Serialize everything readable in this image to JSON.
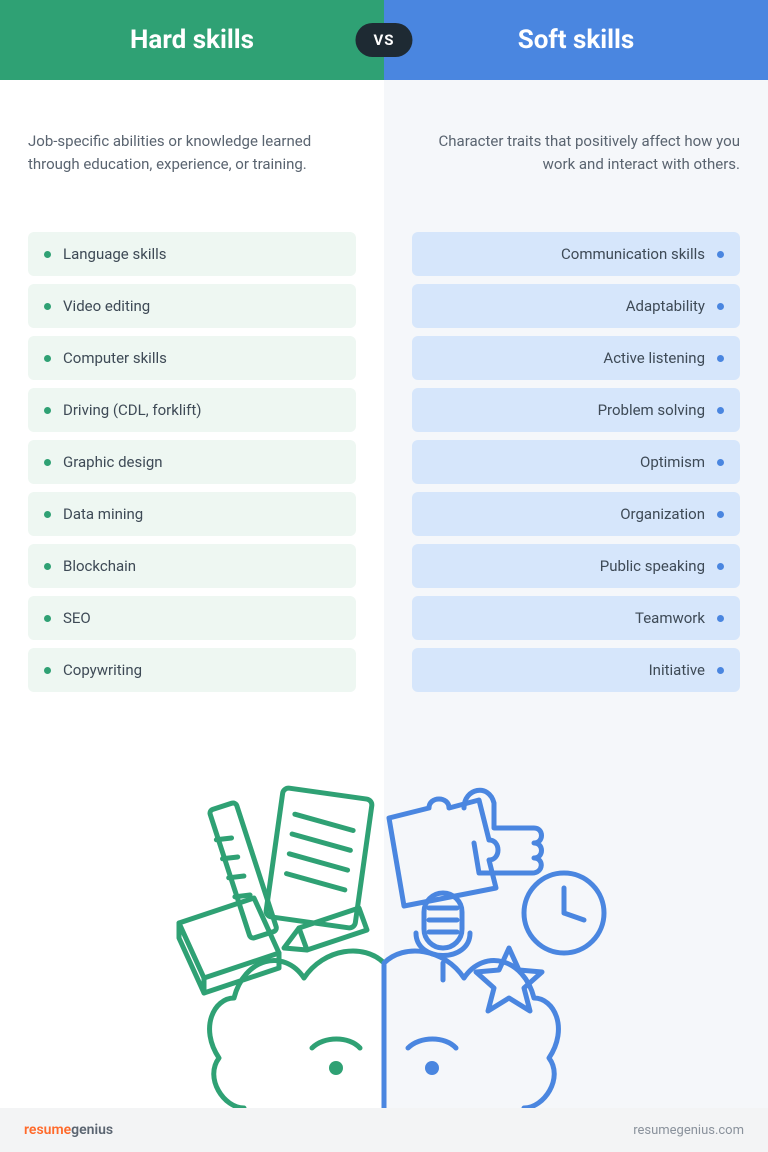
{
  "header": {
    "left_title": "Hard skills",
    "right_title": "Soft skills",
    "vs_label": "VS"
  },
  "left": {
    "description": "Job-specific abilities or knowledge learned through education, experience, or training.",
    "items": [
      "Language skills",
      "Video editing",
      "Computer skills",
      "Driving (CDL, forklift)",
      "Graphic design",
      "Data mining",
      "Blockchain",
      "SEO",
      "Copywriting"
    ]
  },
  "right": {
    "description": "Character traits that positively affect how you work and interact with others.",
    "items": [
      "Communication skills",
      "Adaptability",
      "Active listening",
      "Problem solving",
      "Optimism",
      "Organization",
      "Public speaking",
      "Teamwork",
      "Initiative"
    ]
  },
  "footer": {
    "brand_part1": "resume",
    "brand_part2": "genius",
    "site": "resumegenius.com"
  },
  "colors": {
    "hard": "#2fa174",
    "soft": "#4a86e0"
  }
}
